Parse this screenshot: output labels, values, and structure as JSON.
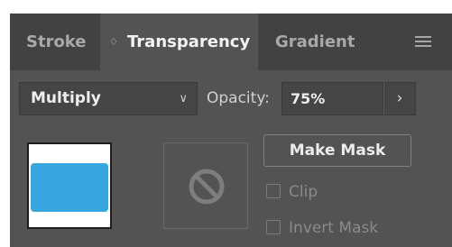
{
  "tabs": [
    {
      "label": "Stroke",
      "active": false
    },
    {
      "label": "Transparency",
      "active": true,
      "arrows_glyph": "♢"
    },
    {
      "label": "Gradient",
      "active": false
    }
  ],
  "panel_menu": {
    "icon": "hamburger-menu-icon"
  },
  "blend_mode": {
    "value": "Multiply",
    "chevron": "∨"
  },
  "opacity": {
    "label": "Opacity:",
    "value": "75%",
    "stepper_glyph": "›"
  },
  "thumbnails": {
    "artwork_color": "#38a7e0",
    "mask_icon": "no-mask-icon"
  },
  "make_mask": {
    "label": "Make Mask"
  },
  "options": {
    "clip": {
      "label": "Clip",
      "checked": false
    },
    "invert_mask": {
      "label": "Invert Mask",
      "checked": false
    }
  },
  "colors": {
    "panel_bg": "#535353",
    "tabbar_bg": "#424242",
    "field_bg": "#454545"
  }
}
